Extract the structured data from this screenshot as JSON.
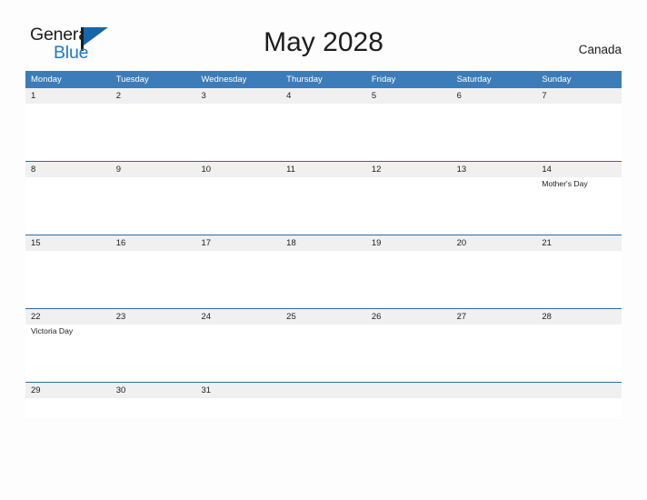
{
  "brand": {
    "name_part1": "General",
    "name_part2": "Blue",
    "flag_icon": "flag-icon",
    "accent_color": "#1666ab"
  },
  "header": {
    "title": "May 2028",
    "country": "Canada"
  },
  "theme": {
    "header_bg": "#3c7cb8",
    "header_text": "#ffffff",
    "row_band_bg": "#f0f0f0",
    "row_divider": "#2b6ca3",
    "page_bg": "#fdfdfd",
    "text": "#1d1d1d"
  },
  "calendar": {
    "weekdays": [
      "Monday",
      "Tuesday",
      "Wednesday",
      "Thursday",
      "Friday",
      "Saturday",
      "Sunday"
    ],
    "weeks": [
      {
        "days": [
          {
            "num": "1",
            "events": []
          },
          {
            "num": "2",
            "events": []
          },
          {
            "num": "3",
            "events": []
          },
          {
            "num": "4",
            "events": []
          },
          {
            "num": "5",
            "events": []
          },
          {
            "num": "6",
            "events": []
          },
          {
            "num": "7",
            "events": []
          }
        ]
      },
      {
        "days": [
          {
            "num": "8",
            "events": []
          },
          {
            "num": "9",
            "events": []
          },
          {
            "num": "10",
            "events": []
          },
          {
            "num": "11",
            "events": []
          },
          {
            "num": "12",
            "events": []
          },
          {
            "num": "13",
            "events": []
          },
          {
            "num": "14",
            "events": [
              "Mother's Day"
            ]
          }
        ]
      },
      {
        "days": [
          {
            "num": "15",
            "events": []
          },
          {
            "num": "16",
            "events": []
          },
          {
            "num": "17",
            "events": []
          },
          {
            "num": "18",
            "events": []
          },
          {
            "num": "19",
            "events": []
          },
          {
            "num": "20",
            "events": []
          },
          {
            "num": "21",
            "events": []
          }
        ]
      },
      {
        "days": [
          {
            "num": "22",
            "events": [
              "Victoria Day"
            ]
          },
          {
            "num": "23",
            "events": []
          },
          {
            "num": "24",
            "events": []
          },
          {
            "num": "25",
            "events": []
          },
          {
            "num": "26",
            "events": []
          },
          {
            "num": "27",
            "events": []
          },
          {
            "num": "28",
            "events": []
          }
        ]
      },
      {
        "days": [
          {
            "num": "29",
            "events": []
          },
          {
            "num": "30",
            "events": []
          },
          {
            "num": "31",
            "events": []
          },
          {
            "num": "",
            "events": []
          },
          {
            "num": "",
            "events": []
          },
          {
            "num": "",
            "events": []
          },
          {
            "num": "",
            "events": []
          }
        ]
      }
    ]
  }
}
